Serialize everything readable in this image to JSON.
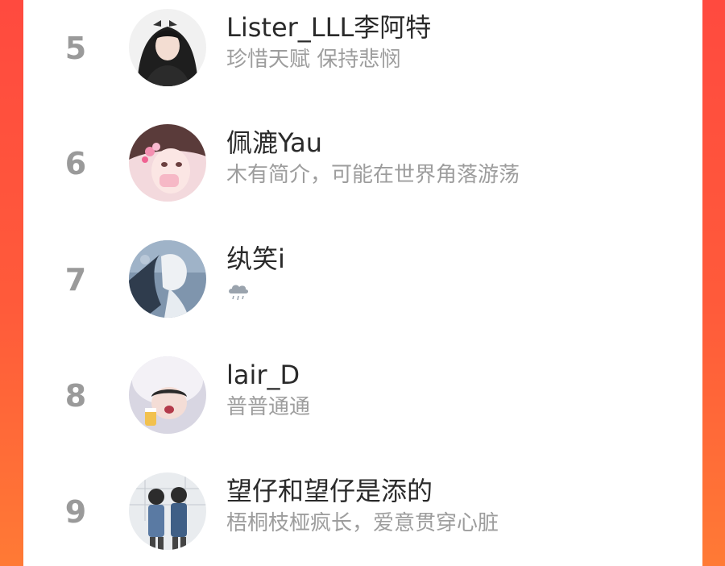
{
  "colors": {
    "background_gradient_start": "#ff4a3f",
    "background_gradient_end": "#ff7a35",
    "panel": "#ffffff",
    "rank_text": "#9a9a9a",
    "name_text": "#2a2a2a",
    "bio_text": "#9d9d9d"
  },
  "ranking": [
    {
      "rank": "5",
      "name": "Lister_LLL李阿特",
      "bio": "珍惜天赋 保持悲悯",
      "avatar_icon": "avatar-dark-hair-girl"
    },
    {
      "rank": "6",
      "name": "佩漉Yau",
      "bio": "木有简介，可能在世界角落游荡",
      "avatar_icon": "avatar-pink-flower-girl"
    },
    {
      "rank": "7",
      "name": "纨笑i",
      "bio": "",
      "bio_icon": "rain-cloud-icon",
      "avatar_icon": "avatar-blue-illustration"
    },
    {
      "rank": "8",
      "name": "lair_D",
      "bio": "普普通通",
      "avatar_icon": "avatar-girl-with-drink"
    },
    {
      "rank": "9",
      "name": "望仔和望仔是添的",
      "bio": "梧桐枝桠疯长，爱意贯穿心脏",
      "avatar_icon": "avatar-couple-illustration"
    }
  ]
}
